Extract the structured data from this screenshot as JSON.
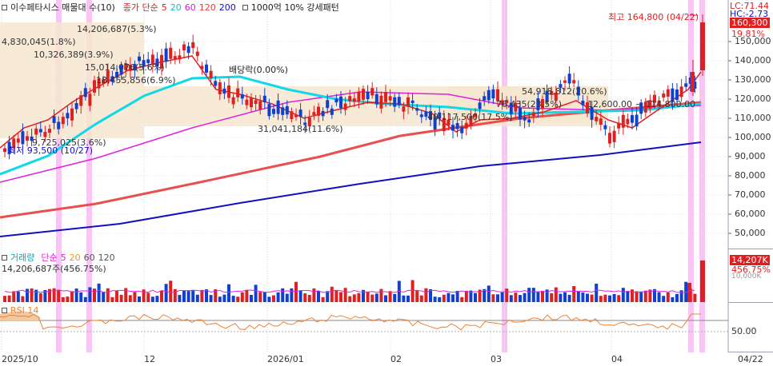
{
  "header": {
    "stock_name": "이수페타시스 매물대 수(10)",
    "ma_label": "종가 단순",
    "ma_periods": [
      "5",
      "20",
      "60",
      "120",
      "200"
    ],
    "ma_colors": [
      "#e02020",
      "#10d0e0",
      "#e020e0",
      "#e04040",
      "#1010c0"
    ],
    "volume_zone_label": "1000억 10% 강세패턴"
  },
  "price_axis": {
    "ticks": [
      "150,000",
      "140,000",
      "130,000",
      "120,000",
      "110,000",
      "100,000",
      "90,000",
      "80,000",
      "70,000",
      "60,000",
      "50,000"
    ],
    "lc": "LC:71.44",
    "hc": "HC:-2.73",
    "current_price": "160,300",
    "change_pct": "19.81%"
  },
  "annotations": {
    "high": "최고 164,800 (04/22)",
    "low": "최저 93,500 (10/27)",
    "dividend": "배당락(0.00%)",
    "zones": [
      "14,206,687(5.3%)",
      "4,830,045(1.8%)",
      "10,326,389(3.9%)",
      "15,014,076(5.6%)",
      "18,455,856(6.9%)",
      "31,041,184(11.6%)",
      "9,725,025(3.6%)",
      "54,918,812(20.6%)",
      "76,435(23.5%)",
      "40,117,500(17.5%)",
      "12,600.00 ~ 114,800.00"
    ]
  },
  "volume": {
    "title": "거래량",
    "ma_label": "단순",
    "ma_periods": [
      "5",
      "20",
      "60",
      "120"
    ],
    "ma_colors": [
      "#e020e0",
      "#e0a020",
      "#555555",
      "#555555"
    ],
    "value_text": "14,206,687주(456.75%)",
    "tag_value": "14,207K",
    "tag_pct": "456.75%",
    "axis_value": "10,000K"
  },
  "rsi": {
    "title": "RSI 14",
    "level": "50.00"
  },
  "x_axis": {
    "labels": [
      "2025/10",
      "12",
      "2026/01",
      "02",
      "03",
      "04"
    ],
    "right_label": "04/22"
  }
}
